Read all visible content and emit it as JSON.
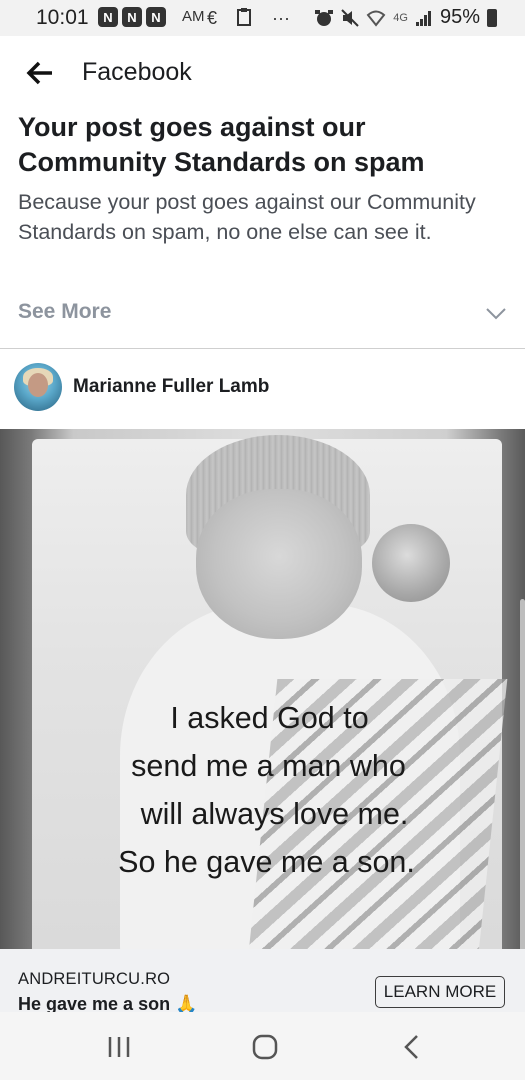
{
  "status_bar": {
    "time": "10:01",
    "notification_badges": [
      "N",
      "N",
      "N"
    ],
    "am_label": "AM",
    "ellipsis": "···",
    "network": "4G",
    "battery": "95%"
  },
  "header": {
    "title": "Facebook"
  },
  "notice": {
    "title": "Your post goes against our Community Standards on spam",
    "body": "Because your post goes against our Community Standards on spam, no one else can see it.",
    "see_more": "See More"
  },
  "post": {
    "author": "Marianne Fuller Lamb",
    "image_caption_lines": [
      "I asked God to",
      "send me a man who",
      "will always love me.",
      "So he gave me a son."
    ]
  },
  "link_preview": {
    "domain": "ANDREITURCU.RO",
    "title": "He gave me a son 🙏",
    "button": "LEARN MORE"
  },
  "colors": {
    "text_primary": "#1c1e21",
    "text_secondary": "#4b4f56",
    "muted": "#8d949e",
    "link_bar_bg": "#f0f1f3"
  }
}
